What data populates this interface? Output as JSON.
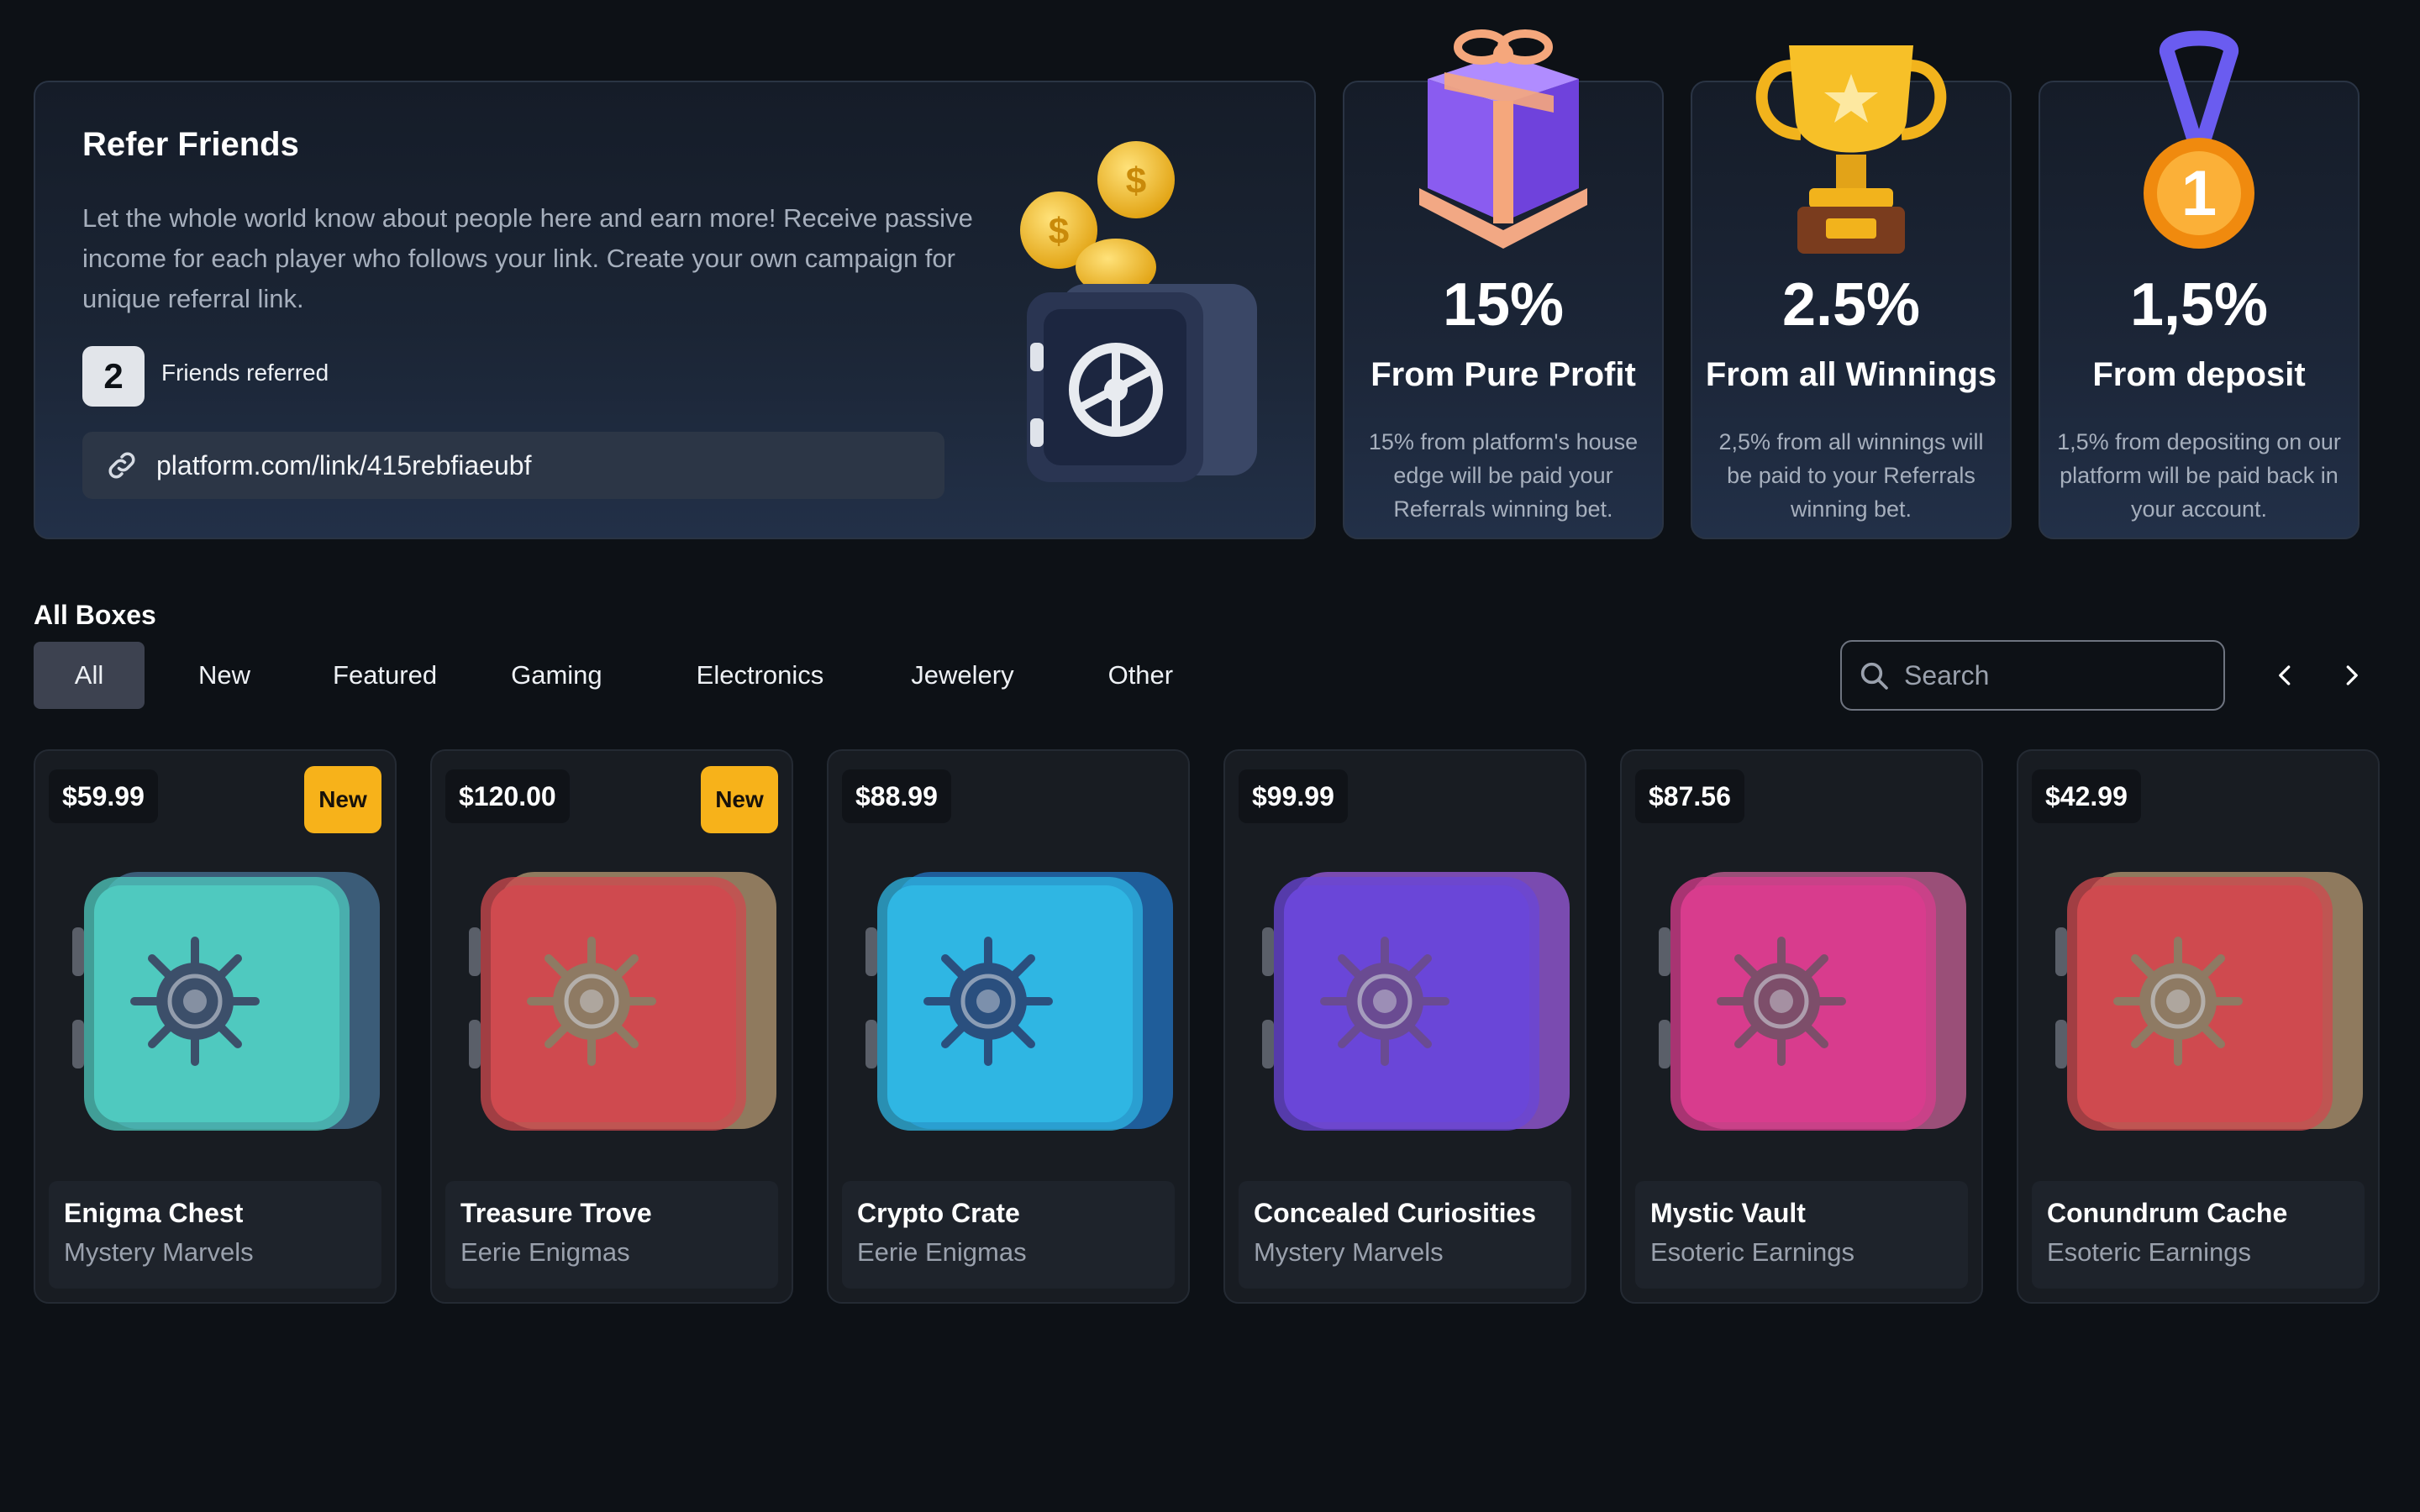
{
  "refer": {
    "title": "Refer Friends",
    "description": "Let the whole world know about people here and earn more! Receive passive income for each player who follows your link. Create your own campaign for unique referral link.",
    "friends_count": "2",
    "friends_label": "Friends referred",
    "link": "platform.com/link/415rebfiaeubf"
  },
  "stats": [
    {
      "value": "15%",
      "label": "From Pure Profit",
      "desc": "15% from platform's house edge will be paid your Referrals winning bet.",
      "icon": "gift-icon"
    },
    {
      "value": "2.5%",
      "label": "From all Winnings",
      "desc": "2,5% from all winnings will be paid to your Referrals winning bet.",
      "icon": "trophy-icon"
    },
    {
      "value": "1,5%",
      "label": "From deposit",
      "desc": "1,5% from depositing on our platform will be paid back in your account.",
      "icon": "medal-icon"
    }
  ],
  "boxes": {
    "title": "All Boxes",
    "tabs": [
      "All",
      "New",
      "Featured",
      "Gaming",
      "Electronics",
      "Jewelery",
      "Other"
    ],
    "search_placeholder": "Search",
    "items": [
      {
        "price": "$59.99",
        "badge": "New",
        "name": "Enigma Chest",
        "category": "Mystery Marvels",
        "color": "#4fc9bf",
        "side": "#3b5c78",
        "dial": "#3c4f6a"
      },
      {
        "price": "$120.00",
        "badge": "New",
        "name": "Treasure Trove",
        "category": "Eerie Enigmas",
        "color": "#cf4a4f",
        "side": "#8f7a5e",
        "dial": "#8e7a63"
      },
      {
        "price": "$88.99",
        "badge": "",
        "name": "Crypto Crate",
        "category": "Eerie Enigmas",
        "color": "#2fb6e3",
        "side": "#1f5d9a",
        "dial": "#2a4f7e"
      },
      {
        "price": "$99.99",
        "badge": "",
        "name": "Concealed Curiosities",
        "category": "Mystery Marvels",
        "color": "#6a46d8",
        "side": "#7a4bb0",
        "dial": "#6a4b92"
      },
      {
        "price": "$87.56",
        "badge": "",
        "name": "Mystic Vault",
        "category": "Esoteric Earnings",
        "color": "#d83c8d",
        "side": "#9a4f78",
        "dial": "#7d4e6a"
      },
      {
        "price": "$42.99",
        "badge": "",
        "name": "Conundrum Cache",
        "category": "Esoteric Earnings",
        "color": "#cf4a4f",
        "side": "#8f7a5e",
        "dial": "#8e7a63"
      }
    ]
  }
}
